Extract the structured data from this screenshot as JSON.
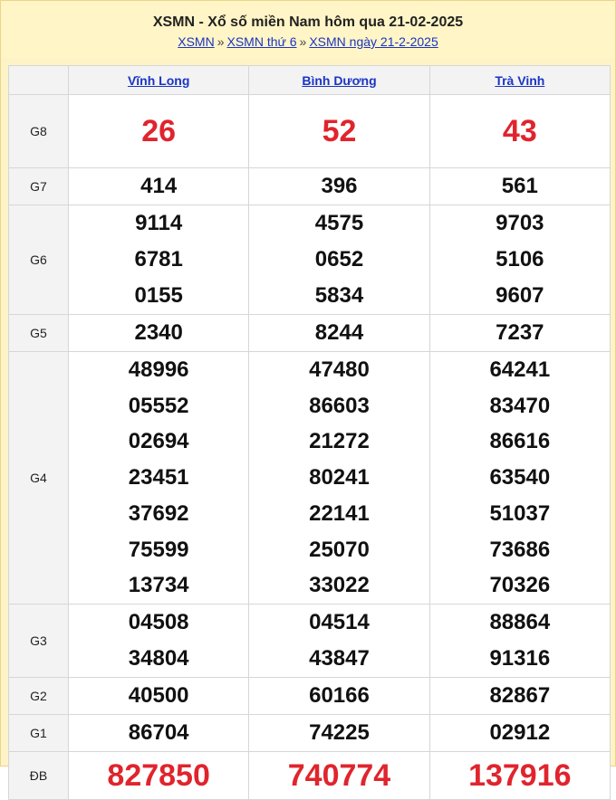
{
  "header": {
    "title": "XSMN - Xổ số miền Nam hôm qua 21-02-2025",
    "breadcrumb": [
      "XSMN",
      "XSMN thứ 6",
      "XSMN ngày 21-2-2025"
    ],
    "separator": "»"
  },
  "provinces": [
    "Vĩnh Long",
    "Bình Dương",
    "Trà Vinh"
  ],
  "prizes": [
    {
      "label": "G8",
      "values": [
        [
          "26"
        ],
        [
          "52"
        ],
        [
          "43"
        ]
      ]
    },
    {
      "label": "G7",
      "values": [
        [
          "414"
        ],
        [
          "396"
        ],
        [
          "561"
        ]
      ]
    },
    {
      "label": "G6",
      "values": [
        [
          "9114",
          "6781",
          "0155"
        ],
        [
          "4575",
          "0652",
          "5834"
        ],
        [
          "9703",
          "5106",
          "9607"
        ]
      ]
    },
    {
      "label": "G5",
      "values": [
        [
          "2340"
        ],
        [
          "8244"
        ],
        [
          "7237"
        ]
      ]
    },
    {
      "label": "G4",
      "values": [
        [
          "48996",
          "05552",
          "02694",
          "23451",
          "37692",
          "75599",
          "13734"
        ],
        [
          "47480",
          "86603",
          "21272",
          "80241",
          "22141",
          "25070",
          "33022"
        ],
        [
          "64241",
          "83470",
          "86616",
          "63540",
          "51037",
          "73686",
          "70326"
        ]
      ]
    },
    {
      "label": "G3",
      "values": [
        [
          "04508",
          "34804"
        ],
        [
          "04514",
          "43847"
        ],
        [
          "88864",
          "91316"
        ]
      ]
    },
    {
      "label": "G2",
      "values": [
        [
          "40500"
        ],
        [
          "60166"
        ],
        [
          "82867"
        ]
      ]
    },
    {
      "label": "G1",
      "values": [
        [
          "86704"
        ],
        [
          "74225"
        ],
        [
          "02912"
        ]
      ]
    },
    {
      "label": "ĐB",
      "values": [
        [
          "827850"
        ],
        [
          "740774"
        ],
        [
          "137916"
        ]
      ]
    }
  ],
  "colors": {
    "header_bg": "#fff5c6",
    "link": "#1a35c4",
    "highlight_red": "#e0242d",
    "label_bg": "#f3f3f3"
  }
}
